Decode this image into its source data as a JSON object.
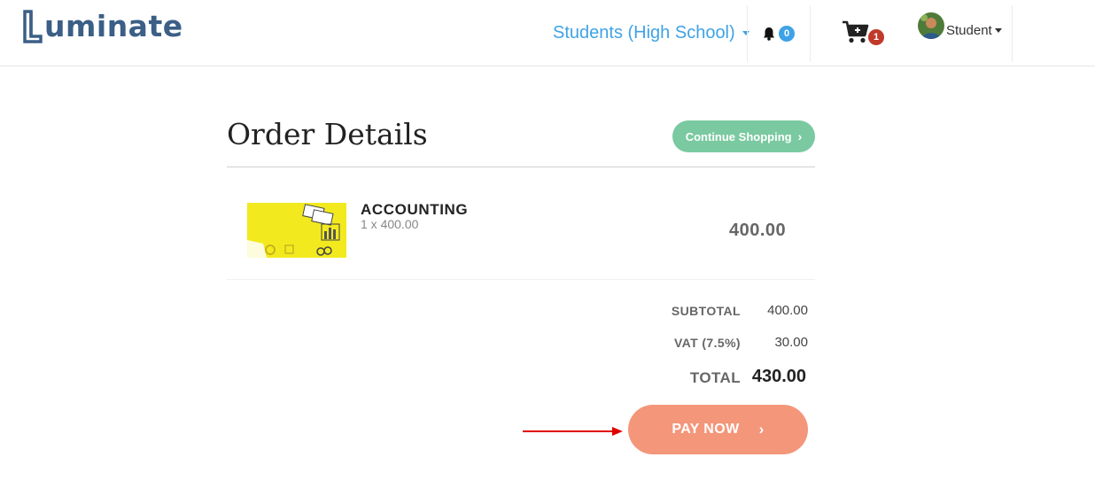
{
  "brand": {
    "name": "uminate",
    "accent": "#3b5f86"
  },
  "nav": {
    "level_select": {
      "value": "Students (High School)",
      "color": "#3fa2e6"
    },
    "notifications": {
      "icon": "bell-icon",
      "count": "0"
    },
    "cart": {
      "icon": "cart-plus-icon",
      "count": "1"
    },
    "user": {
      "label": "Student"
    }
  },
  "order": {
    "title": "Order Details",
    "continue_label": "Continue Shopping",
    "item": {
      "name": "ACCOUNTING",
      "qty_line": "1 x 400.00",
      "price": "400.00"
    },
    "summary": {
      "subtotal_label": "SUBTOTAL",
      "subtotal": "400.00",
      "vat_label": "VAT (7.5%)",
      "vat": "30.00",
      "total_label": "TOTAL",
      "total": "430.00"
    },
    "pay_label": "PAY NOW"
  },
  "colors": {
    "pay_button": "#f4967a",
    "continue_button": "#7ac9a0",
    "annotation_arrow": "#e00000"
  }
}
